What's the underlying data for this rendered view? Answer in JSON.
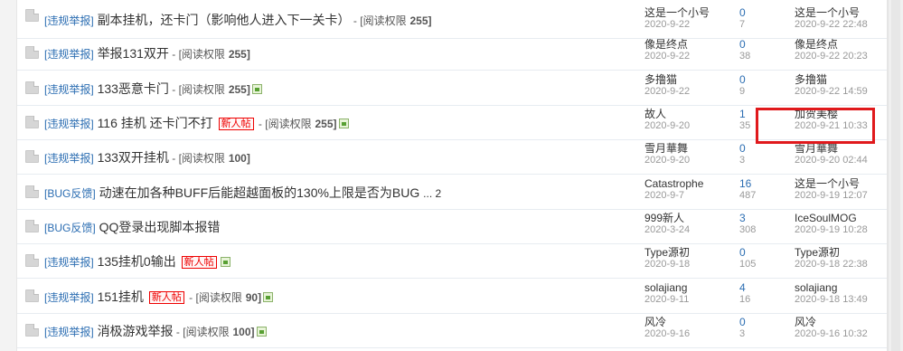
{
  "rows": [
    {
      "type": "[违规举报]",
      "title": "副本挂机，还卡门（影响他人进入下一关卡）",
      "new": false,
      "perm_label": "[阅读权限",
      "perm_value": "255",
      "perm_close": "]",
      "has_image": false,
      "pages": "",
      "author": "这是一个小号",
      "date": "2020-9-22",
      "replies": "0",
      "views": "7",
      "last_user": "这是一个小号",
      "last_time": "2020-9-22 22:48"
    },
    {
      "type": "[违规举报]",
      "title": "举报131双开",
      "new": false,
      "perm_label": "[阅读权限",
      "perm_value": "255",
      "perm_close": "]",
      "has_image": false,
      "pages": "",
      "author": "像是终点",
      "date": "2020-9-22",
      "replies": "0",
      "views": "38",
      "last_user": "像是终点",
      "last_time": "2020-9-22 20:23"
    },
    {
      "type": "[违规举报]",
      "title": "133恶意卡门",
      "new": false,
      "perm_label": "[阅读权限",
      "perm_value": "255",
      "perm_close": "]",
      "has_image": true,
      "pages": "",
      "author": "多撸猫",
      "date": "2020-9-22",
      "replies": "0",
      "views": "9",
      "last_user": "多撸猫",
      "last_time": "2020-9-22 14:59"
    },
    {
      "type": "[违规举报]",
      "title": "116 挂机 还卡门不打",
      "new": true,
      "new_label": "新人帖",
      "perm_label": "[阅读权限",
      "perm_value": "255",
      "perm_close": "]",
      "has_image": true,
      "pages": "",
      "author": "故人",
      "date": "2020-9-20",
      "replies": "1",
      "views": "35",
      "last_user": "加贺美樱",
      "last_time": "2020-9-21 10:33"
    },
    {
      "type": "[违规举报]",
      "title": "133双开挂机",
      "new": false,
      "perm_label": "[阅读权限",
      "perm_value": "100",
      "perm_close": "]",
      "has_image": false,
      "pages": "",
      "author": "雪月華舞",
      "date": "2020-9-20",
      "replies": "0",
      "views": "3",
      "last_user": "雪月華舞",
      "last_time": "2020-9-20 02:44"
    },
    {
      "type": "[BUG反馈]",
      "title": "动速在加各种BUFF后能超越面板的130%上限是否为BUG",
      "new": false,
      "perm_label": "",
      "perm_value": "",
      "perm_close": "",
      "has_image": false,
      "pages": "... 2",
      "author": "Catastrophe",
      "date": "2020-9-7",
      "replies": "16",
      "views": "487",
      "last_user": "这是一个小号",
      "last_time": "2020-9-19 12:07"
    },
    {
      "type": "[BUG反馈]",
      "title": "QQ登录出现脚本报错",
      "new": false,
      "perm_label": "",
      "perm_value": "",
      "perm_close": "",
      "has_image": false,
      "pages": "",
      "author": "999新人",
      "date": "2020-3-24",
      "replies": "3",
      "views": "308",
      "last_user": "IceSoulMOG",
      "last_time": "2020-9-19 10:28"
    },
    {
      "type": "[违规举报]",
      "title": "135挂机0输出",
      "new": true,
      "new_label": "新人帖",
      "perm_label": "",
      "perm_value": "",
      "perm_close": "",
      "has_image": true,
      "pages": "",
      "author": "Type源初",
      "date": "2020-9-18",
      "replies": "0",
      "views": "105",
      "last_user": "Type源初",
      "last_time": "2020-9-18 22:38"
    },
    {
      "type": "[违规举报]",
      "title": "151挂机",
      "new": true,
      "new_label": "新人帖",
      "perm_label": "[阅读权限",
      "perm_value": "90",
      "perm_close": "]",
      "has_image": true,
      "pages": "",
      "author": "solajiang",
      "date": "2020-9-11",
      "replies": "4",
      "views": "16",
      "last_user": "solajiang",
      "last_time": "2020-9-18 13:49"
    },
    {
      "type": "[违规举报]",
      "title": "消极游戏举报",
      "new": false,
      "perm_label": "[阅读权限",
      "perm_value": "100",
      "perm_close": "]",
      "has_image": true,
      "pages": "",
      "author": "风冷",
      "date": "2020-9-16",
      "replies": "0",
      "views": "3",
      "last_user": "风冷",
      "last_time": "2020-9-16 10:32"
    }
  ],
  "colors": {
    "link": "#2b6db2",
    "highlight": "#e0191c",
    "new_badge": "#e00"
  }
}
